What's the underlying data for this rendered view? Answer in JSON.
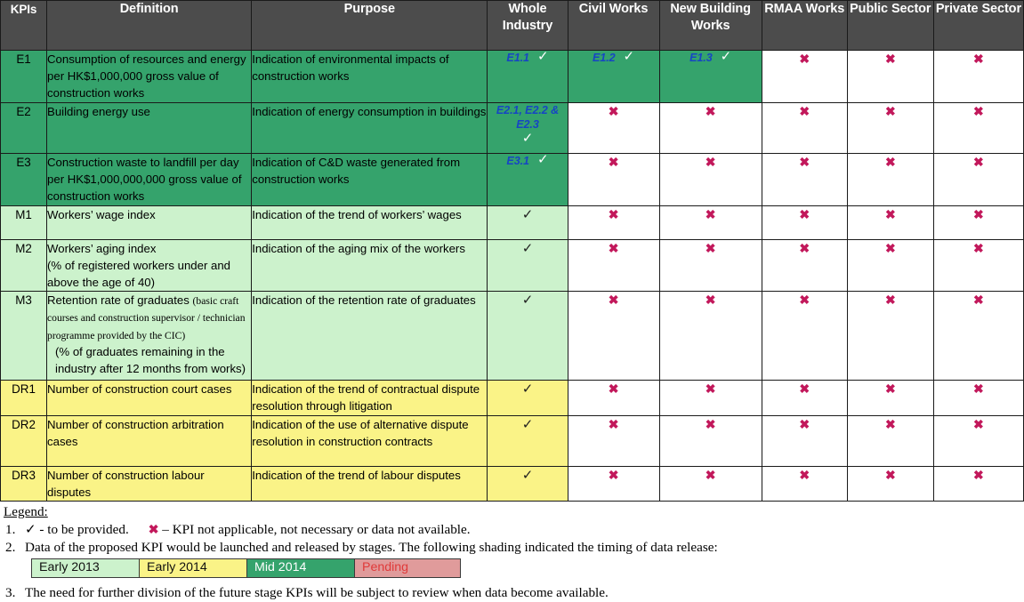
{
  "table": {
    "columns": [
      {
        "id": "kpis",
        "label": "KPIs"
      },
      {
        "id": "definition",
        "label": "Definition"
      },
      {
        "id": "purpose",
        "label": "Purpose"
      },
      {
        "id": "whole_industry",
        "label": "Whole Industry"
      },
      {
        "id": "civil_works",
        "label": "Civil Works"
      },
      {
        "id": "new_building_works",
        "label": "New Building Works"
      },
      {
        "id": "rmaa_works",
        "label": "RMAA Works"
      },
      {
        "id": "public_sector",
        "label": "Public Sector"
      },
      {
        "id": "private_sector",
        "label": "Private Sector"
      }
    ],
    "rows": [
      {
        "kpi": "E1",
        "shading": "mid2014",
        "definition": "Consumption of resources and energy per HK$1,000,000 gross value of construction works",
        "purpose": "Indication of environmental impacts of construction works",
        "whole_industry": {
          "code": "E1.1",
          "mark": "tick",
          "shading": "mid2014"
        },
        "civil_works": {
          "code": "E1.2",
          "mark": "tick",
          "shading": "mid2014"
        },
        "new_building_works": {
          "code": "E1.3",
          "mark": "tick",
          "shading": "mid2014"
        },
        "rmaa_works": {
          "code": "",
          "mark": "cross",
          "shading": "none"
        },
        "public_sector": {
          "code": "",
          "mark": "cross",
          "shading": "none"
        },
        "private_sector": {
          "code": "",
          "mark": "cross",
          "shading": "none"
        }
      },
      {
        "kpi": "E2",
        "shading": "mid2014",
        "definition": "Building energy use",
        "purpose": "Indication of energy consumption in buildings",
        "whole_industry": {
          "code": "E2.1, E2.2 & E2.3",
          "mark": "tick",
          "shading": "mid2014",
          "stacked": true
        },
        "civil_works": {
          "code": "",
          "mark": "cross",
          "shading": "none"
        },
        "new_building_works": {
          "code": "",
          "mark": "cross",
          "shading": "none"
        },
        "rmaa_works": {
          "code": "",
          "mark": "cross",
          "shading": "none"
        },
        "public_sector": {
          "code": "",
          "mark": "cross",
          "shading": "none"
        },
        "private_sector": {
          "code": "",
          "mark": "cross",
          "shading": "none"
        }
      },
      {
        "kpi": "E3",
        "shading": "mid2014",
        "definition": "Construction waste to landfill per day per HK$1,000,000,000 gross value of construction works",
        "purpose": "Indication of C&D waste generated from construction works",
        "whole_industry": {
          "code": "E3.1",
          "mark": "tick",
          "shading": "mid2014"
        },
        "civil_works": {
          "code": "",
          "mark": "cross",
          "shading": "none"
        },
        "new_building_works": {
          "code": "",
          "mark": "cross",
          "shading": "none"
        },
        "rmaa_works": {
          "code": "",
          "mark": "cross",
          "shading": "none"
        },
        "public_sector": {
          "code": "",
          "mark": "cross",
          "shading": "none"
        },
        "private_sector": {
          "code": "",
          "mark": "cross",
          "shading": "none"
        }
      },
      {
        "kpi": "M1",
        "shading": "early2013",
        "definition": "Workers’ wage index",
        "purpose": "Indication of the trend of workers’ wages",
        "whole_industry": {
          "code": "",
          "mark": "tick",
          "shading": "early2013"
        },
        "civil_works": {
          "code": "",
          "mark": "cross",
          "shading": "none"
        },
        "new_building_works": {
          "code": "",
          "mark": "cross",
          "shading": "none"
        },
        "rmaa_works": {
          "code": "",
          "mark": "cross",
          "shading": "none"
        },
        "public_sector": {
          "code": "",
          "mark": "cross",
          "shading": "none"
        },
        "private_sector": {
          "code": "",
          "mark": "cross",
          "shading": "none"
        }
      },
      {
        "kpi": "M2",
        "shading": "early2013",
        "definition": "Workers’ aging index\n(% of registered workers under and above the age of 40)",
        "purpose": "Indication of the aging mix of the workers",
        "whole_industry": {
          "code": "",
          "mark": "tick",
          "shading": "early2013"
        },
        "civil_works": {
          "code": "",
          "mark": "cross",
          "shading": "none"
        },
        "new_building_works": {
          "code": "",
          "mark": "cross",
          "shading": "none"
        },
        "rmaa_works": {
          "code": "",
          "mark": "cross",
          "shading": "none"
        },
        "public_sector": {
          "code": "",
          "mark": "cross",
          "shading": "none"
        },
        "private_sector": {
          "code": "",
          "mark": "cross",
          "shading": "none"
        }
      },
      {
        "kpi": "M3",
        "shading": "early2013",
        "definition_main": "Retention rate of graduates ",
        "definition_note": "(basic craft courses and construction supervisor / technician programme provided by the CIC)",
        "definition_tail": "(% of graduates remaining in the industry after 12 months from works)",
        "purpose": "Indication of the retention rate of graduates",
        "whole_industry": {
          "code": "",
          "mark": "tick",
          "shading": "early2013"
        },
        "civil_works": {
          "code": "",
          "mark": "cross",
          "shading": "none"
        },
        "new_building_works": {
          "code": "",
          "mark": "cross",
          "shading": "none"
        },
        "rmaa_works": {
          "code": "",
          "mark": "cross",
          "shading": "none"
        },
        "public_sector": {
          "code": "",
          "mark": "cross",
          "shading": "none"
        },
        "private_sector": {
          "code": "",
          "mark": "cross",
          "shading": "none"
        }
      },
      {
        "kpi": "DR1",
        "shading": "early2014",
        "definition": "Number of construction court cases",
        "purpose": "Indication of the trend of contractual dispute resolution through litigation",
        "whole_industry": {
          "code": "",
          "mark": "tick",
          "shading": "early2014"
        },
        "civil_works": {
          "code": "",
          "mark": "cross",
          "shading": "none"
        },
        "new_building_works": {
          "code": "",
          "mark": "cross",
          "shading": "none"
        },
        "rmaa_works": {
          "code": "",
          "mark": "cross",
          "shading": "none"
        },
        "public_sector": {
          "code": "",
          "mark": "cross",
          "shading": "none"
        },
        "private_sector": {
          "code": "",
          "mark": "cross",
          "shading": "none"
        }
      },
      {
        "kpi": "DR2",
        "shading": "early2014",
        "definition": "Number of construction arbitration cases",
        "purpose": "Indication of the use of alternative dispute resolution in construction contracts",
        "whole_industry": {
          "code": "",
          "mark": "tick",
          "shading": "early2014"
        },
        "civil_works": {
          "code": "",
          "mark": "cross",
          "shading": "none"
        },
        "new_building_works": {
          "code": "",
          "mark": "cross",
          "shading": "none"
        },
        "rmaa_works": {
          "code": "",
          "mark": "cross",
          "shading": "none"
        },
        "public_sector": {
          "code": "",
          "mark": "cross",
          "shading": "none"
        },
        "private_sector": {
          "code": "",
          "mark": "cross",
          "shading": "none"
        }
      },
      {
        "kpi": "DR3",
        "shading": "early2014",
        "definition": "Number of construction labour disputes",
        "purpose": "Indication of the trend of labour disputes",
        "whole_industry": {
          "code": "",
          "mark": "tick",
          "shading": "early2014"
        },
        "civil_works": {
          "code": "",
          "mark": "cross",
          "shading": "none"
        },
        "new_building_works": {
          "code": "",
          "mark": "cross",
          "shading": "none"
        },
        "rmaa_works": {
          "code": "",
          "mark": "cross",
          "shading": "none"
        },
        "public_sector": {
          "code": "",
          "mark": "cross",
          "shading": "none"
        },
        "private_sector": {
          "code": "",
          "mark": "cross",
          "shading": "none"
        }
      }
    ]
  },
  "legend": {
    "title": "Legend:",
    "item1_num": "1.",
    "item1_tick_text": "- to be provided.",
    "item1_cross_text": "– KPI not applicable, not necessary or data not available.",
    "item2_num": "2.",
    "item2_text": "Data of the proposed KPI would be launched and released by stages. The following shading indicated the timing of data release:",
    "item3_num": "3.",
    "item3_text": "The need for further division of the future stage KPIs will be subject to review when data become available.",
    "swatches": [
      {
        "label": "Early 2013",
        "color": "#ccf2cc"
      },
      {
        "label": "Early 2014",
        "color": "#faf387"
      },
      {
        "label": "Mid 2014",
        "color": "#35a36c"
      },
      {
        "label": "Pending",
        "color": "#e09b9b"
      }
    ]
  },
  "glyphs": {
    "tick": "✓",
    "cross": "✖"
  }
}
